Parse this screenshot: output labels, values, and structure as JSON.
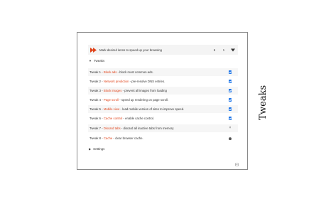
{
  "topbar": {
    "message": "Mark desired items to speed up your browsing",
    "num_a": "6",
    "num_b": "1"
  },
  "sections": {
    "tweaks_label": "Tweaks",
    "settings_label": "Settings"
  },
  "tweaks": [
    {
      "prefix": "Tweak 1 - ",
      "name": "Block ads",
      "desc": " - block most common ads.",
      "control": "checked"
    },
    {
      "prefix": "Tweak 2 - ",
      "name": "Network prediction",
      "desc": " - pre-resolve DNS entries.",
      "control": "checked"
    },
    {
      "prefix": "Tweak 3 - ",
      "name": "Block images",
      "desc": " - prevent all images from loading",
      "control": "checked"
    },
    {
      "prefix": "Tweak 4 - ",
      "name": "Page scroll",
      "desc": " - speed up rendering on page scroll.",
      "control": "checked"
    },
    {
      "prefix": "Tweak 5 - ",
      "name": "Mobile view",
      "desc": " - load mobile version of sites to improve speed.",
      "control": "checked"
    },
    {
      "prefix": "Tweak 6 - ",
      "name": "Cache control",
      "desc": " - enable cache control.",
      "control": "checked"
    },
    {
      "prefix": "Tweak 7 - ",
      "name": "Discard tabs",
      "desc": " - discard all inactive tabs from memory.",
      "control": "close"
    },
    {
      "prefix": "Tweak 8 - ",
      "name": "Cache",
      "desc": " - clear browser cache.",
      "control": "clear"
    }
  ],
  "side_label": "Tweaks",
  "colors": {
    "accent": "#e0441b",
    "checkbox": "#1a73e8",
    "border": "#8a8a8a"
  }
}
